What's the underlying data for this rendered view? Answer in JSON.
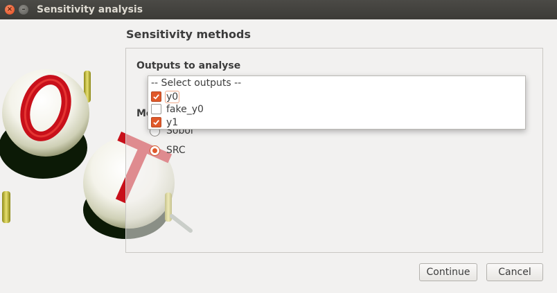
{
  "window": {
    "title": "Sensitivity analysis",
    "controls": {
      "close_icon": "close-icon",
      "minimize_icon": "minimize-icon"
    }
  },
  "main": {
    "section_title": "Sensitivity methods",
    "outputs_label": "Outputs to analyse",
    "methods_label": "Me",
    "outputs_dropdown": {
      "header": "-- Select outputs --",
      "items": [
        {
          "label": "y0",
          "checked": true
        },
        {
          "label": "fake_y0",
          "checked": false
        },
        {
          "label": "y1",
          "checked": true
        }
      ]
    },
    "methods": [
      {
        "label": "Sobol",
        "selected": false
      },
      {
        "label": "SRC",
        "selected": true
      }
    ]
  },
  "footer": {
    "continue_label": "Continue",
    "cancel_label": "Cancel"
  },
  "colors": {
    "accent": "#e0592a",
    "titlebar": "#3c3b37",
    "logo_red": "#c8101a"
  },
  "logo": {
    "letters": "OT"
  }
}
